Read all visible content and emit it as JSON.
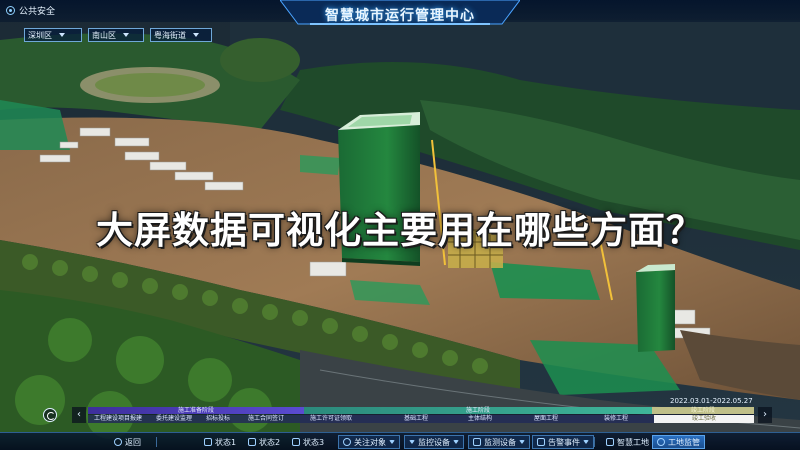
{
  "header": {
    "app_label": "公共安全",
    "title": "智慧城市运行管理中心",
    "regions": [
      {
        "value": "深圳区"
      },
      {
        "value": "南山区"
      },
      {
        "value": "粤海街道"
      }
    ]
  },
  "overlay": {
    "headline": "大屏数据可视化主要用在哪些方面？"
  },
  "timeline": {
    "date_range": "2022.03.01-2022.05.27",
    "phases": [
      {
        "label": "施工准备阶段"
      },
      {
        "label": "施工阶段"
      },
      {
        "label": "竣工阶段"
      }
    ],
    "items": [
      {
        "label": "工程建设项目报建"
      },
      {
        "label": "委托建设监理"
      },
      {
        "label": "招标投标"
      },
      {
        "label": "施工合同签订"
      },
      {
        "label": "施工许可证领取"
      },
      {
        "label": "基础工程"
      },
      {
        "label": "主体结构"
      },
      {
        "label": "屋面工程"
      },
      {
        "label": "装修工程"
      }
    ],
    "current": "竣工验收"
  },
  "toolbar": {
    "back": "返回",
    "state1": "状态1",
    "state2": "状态2",
    "state3": "状态3",
    "focus": "关注对象",
    "monitor": "监控设备",
    "monitor_device": "监测设备",
    "alarm": "告警事件",
    "site": "智慧工地",
    "supervision": "工地监管"
  },
  "colors": {
    "accent": "#2a6fc1",
    "phase_prep": "#5a4bd1",
    "phase_build": "#3fb59a",
    "phase_done": "#bfbf88",
    "tower": "#1f7a3c"
  }
}
